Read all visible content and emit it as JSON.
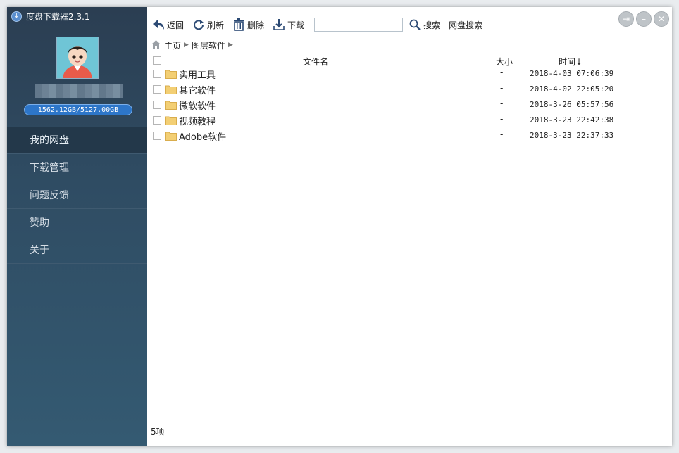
{
  "app": {
    "title": "度盘下载器2.3.1",
    "quota": "1562.12GB/5127.00GB"
  },
  "sidebar": {
    "items": [
      {
        "label": "我的网盘",
        "active": true
      },
      {
        "label": "下载管理"
      },
      {
        "label": "问题反馈"
      },
      {
        "label": "赞助"
      },
      {
        "label": "关于"
      }
    ]
  },
  "toolbar": {
    "back_label": "返回",
    "refresh_label": "刷新",
    "delete_label": "删除",
    "download_label": "下载",
    "search_value": "",
    "search_label": "搜索",
    "pan_search_label": "网盘搜索"
  },
  "breadcrumb": {
    "home": "主页",
    "current": "图层软件"
  },
  "table": {
    "headers": {
      "name": "文件名",
      "size": "大小",
      "time": "时间↓"
    },
    "rows": [
      {
        "name": "实用工具",
        "size": "-",
        "time": "2018-4-03 07:06:39"
      },
      {
        "name": "其它软件",
        "size": "-",
        "time": "2018-4-02 22:05:20"
      },
      {
        "name": "微软软件",
        "size": "-",
        "time": "2018-3-26 05:57:56"
      },
      {
        "name": "视频教程",
        "size": "-",
        "time": "2018-3-23 22:42:38"
      },
      {
        "name": "Adobe软件",
        "size": "-",
        "time": "2018-3-23 22:37:33"
      }
    ]
  },
  "status": {
    "count": "5项"
  },
  "colors": {
    "sidebar": "#2f4c63",
    "quota_bg": "#2d76c9",
    "folder": "#f3cf74"
  }
}
